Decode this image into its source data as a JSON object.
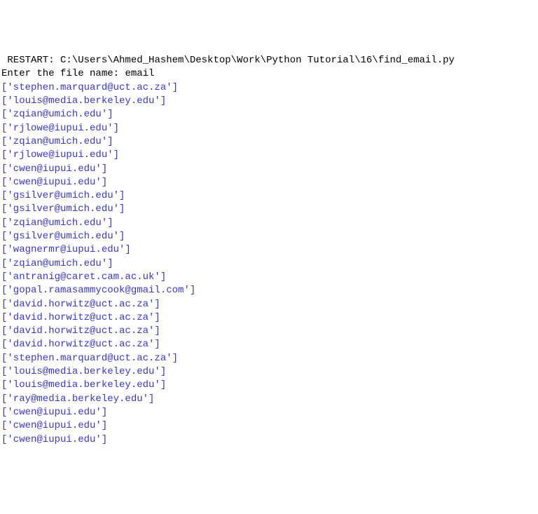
{
  "restart_label": " RESTART: ",
  "restart_path": "C:\\Users\\Ahmed_Hashem\\Desktop\\Work\\Python Tutorial\\16\\find_email.py",
  "prompt_text": "Enter the file name: ",
  "user_input": "email",
  "output_lines": [
    "['stephen.marquard@uct.ac.za']",
    "['louis@media.berkeley.edu']",
    "['zqian@umich.edu']",
    "['rjlowe@iupui.edu']",
    "['zqian@umich.edu']",
    "['rjlowe@iupui.edu']",
    "['cwen@iupui.edu']",
    "['cwen@iupui.edu']",
    "['gsilver@umich.edu']",
    "['gsilver@umich.edu']",
    "['zqian@umich.edu']",
    "['gsilver@umich.edu']",
    "['wagnermr@iupui.edu']",
    "['zqian@umich.edu']",
    "['antranig@caret.cam.ac.uk']",
    "['gopal.ramasammycook@gmail.com']",
    "['david.horwitz@uct.ac.za']",
    "['david.horwitz@uct.ac.za']",
    "['david.horwitz@uct.ac.za']",
    "['david.horwitz@uct.ac.za']",
    "['stephen.marquard@uct.ac.za']",
    "['louis@media.berkeley.edu']",
    "['louis@media.berkeley.edu']",
    "['ray@media.berkeley.edu']",
    "['cwen@iupui.edu']",
    "['cwen@iupui.edu']",
    "['cwen@iupui.edu']"
  ]
}
